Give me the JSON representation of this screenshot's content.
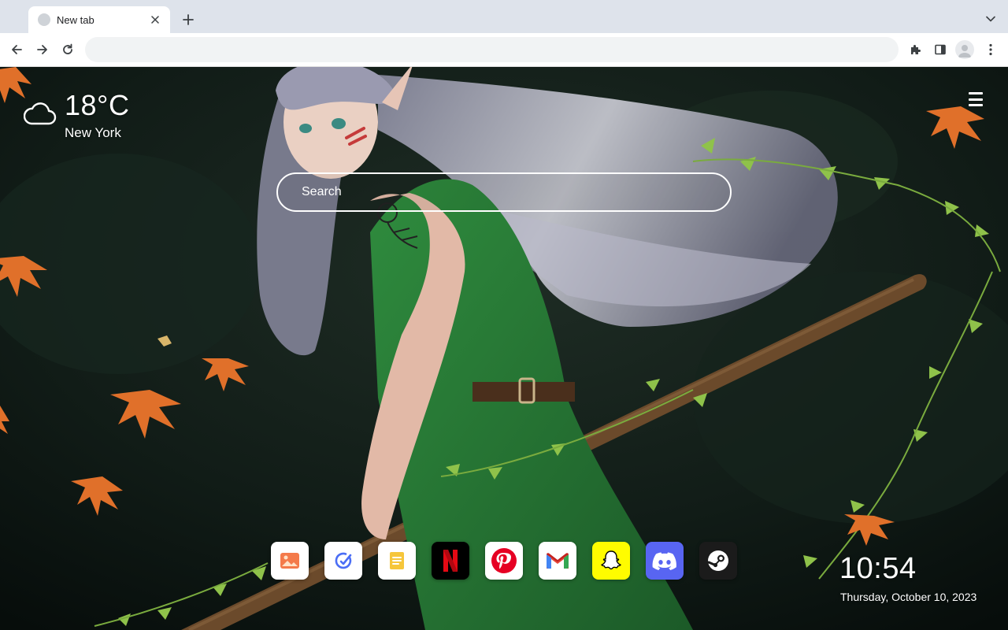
{
  "tab": {
    "title": "New tab"
  },
  "omnibox": {
    "value": ""
  },
  "weather": {
    "temperature": "18°C",
    "city": "New York",
    "icon": "cloud-icon"
  },
  "search": {
    "placeholder": "Search"
  },
  "dock": [
    {
      "name": "photos",
      "icon": "photos-icon",
      "bg": "#ffffff"
    },
    {
      "name": "link-check",
      "icon": "check-icon",
      "bg": "#ffffff"
    },
    {
      "name": "notes",
      "icon": "notes-icon",
      "bg": "#ffffff"
    },
    {
      "name": "netflix",
      "icon": "netflix-icon",
      "bg": "#000000"
    },
    {
      "name": "pinterest",
      "icon": "pinterest-icon",
      "bg": "#ffffff"
    },
    {
      "name": "gmail",
      "icon": "gmail-icon",
      "bg": "#ffffff"
    },
    {
      "name": "snapchat",
      "icon": "snapchat-icon",
      "bg": "#fffc00"
    },
    {
      "name": "discord",
      "icon": "discord-icon",
      "bg": "#5865f2"
    },
    {
      "name": "steam",
      "icon": "steam-icon",
      "bg": "#1b1b1b"
    }
  ],
  "clock": {
    "time": "10:54",
    "date": "Thursday, October 10, 2023"
  }
}
